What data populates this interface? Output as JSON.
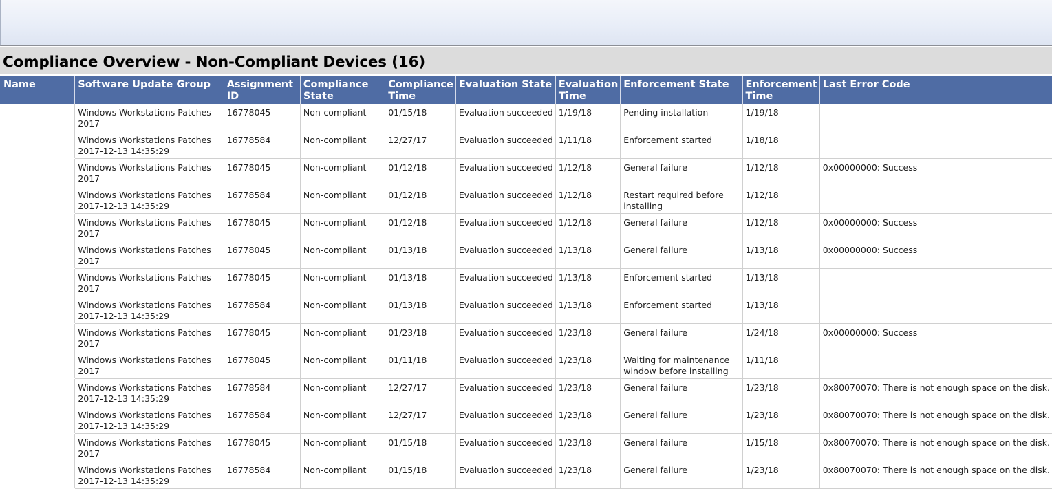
{
  "report": {
    "title": "Compliance Overview - Non-Compliant Devices (16)"
  },
  "table": {
    "headers": [
      "Name",
      "Software Update Group",
      "Assignment ID",
      "Compliance State",
      "Compliance Time",
      "Evaluation State",
      "Evaluation Time",
      "Enforcement State",
      "Enforcement Time",
      "Last Error Code"
    ],
    "rows": [
      [
        "",
        "Windows Workstations Patches 2017",
        "16778045",
        "Non-compliant",
        "01/15/18",
        "Evaluation succeeded",
        "1/19/18",
        "Pending installation",
        "1/19/18",
        ""
      ],
      [
        "",
        "Windows Workstations Patches 2017-12-13 14:35:29",
        "16778584",
        "Non-compliant",
        "12/27/17",
        "Evaluation succeeded",
        "1/11/18",
        "Enforcement started",
        "1/18/18",
        ""
      ],
      [
        "",
        "Windows Workstations Patches 2017",
        "16778045",
        "Non-compliant",
        "01/12/18",
        "Evaluation succeeded",
        "1/12/18",
        "General failure",
        "1/12/18",
        "0x00000000: Success"
      ],
      [
        "",
        "Windows Workstations Patches 2017-12-13 14:35:29",
        "16778584",
        "Non-compliant",
        "01/12/18",
        "Evaluation succeeded",
        "1/12/18",
        "Restart required before installing",
        "1/12/18",
        ""
      ],
      [
        "",
        "Windows Workstations Patches 2017",
        "16778045",
        "Non-compliant",
        "01/12/18",
        "Evaluation succeeded",
        "1/12/18",
        "General failure",
        "1/12/18",
        "0x00000000: Success"
      ],
      [
        "",
        "Windows Workstations Patches 2017",
        "16778045",
        "Non-compliant",
        "01/13/18",
        "Evaluation succeeded",
        "1/13/18",
        "General failure",
        "1/13/18",
        "0x00000000: Success"
      ],
      [
        "",
        "Windows Workstations Patches 2017",
        "16778045",
        "Non-compliant",
        "01/13/18",
        "Evaluation succeeded",
        "1/13/18",
        "Enforcement started",
        "1/13/18",
        ""
      ],
      [
        "",
        "Windows Workstations Patches 2017-12-13 14:35:29",
        "16778584",
        "Non-compliant",
        "01/13/18",
        "Evaluation succeeded",
        "1/13/18",
        "Enforcement started",
        "1/13/18",
        ""
      ],
      [
        "",
        "Windows Workstations Patches 2017",
        "16778045",
        "Non-compliant",
        "01/23/18",
        "Evaluation succeeded",
        "1/23/18",
        "General failure",
        "1/24/18",
        "0x00000000: Success"
      ],
      [
        "",
        "Windows Workstations Patches 2017",
        "16778045",
        "Non-compliant",
        "01/11/18",
        "Evaluation succeeded",
        "1/23/18",
        "Waiting for maintenance window before installing",
        "1/11/18",
        ""
      ],
      [
        "",
        "Windows Workstations Patches 2017-12-13 14:35:29",
        "16778584",
        "Non-compliant",
        "12/27/17",
        "Evaluation succeeded",
        "1/23/18",
        "General failure",
        "1/23/18",
        "0x80070070: There is not enough space on the disk."
      ],
      [
        "",
        "Windows Workstations Patches 2017-12-13 14:35:29",
        "16778584",
        "Non-compliant",
        "12/27/17",
        "Evaluation succeeded",
        "1/23/18",
        "General failure",
        "1/23/18",
        "0x80070070: There is not enough space on the disk."
      ],
      [
        "",
        "Windows Workstations Patches 2017",
        "16778045",
        "Non-compliant",
        "01/15/18",
        "Evaluation succeeded",
        "1/23/18",
        "General failure",
        "1/15/18",
        "0x80070070: There is not enough space on the disk."
      ],
      [
        "",
        "Windows Workstations Patches 2017-12-13 14:35:29",
        "16778584",
        "Non-compliant",
        "01/15/18",
        "Evaluation succeeded",
        "1/23/18",
        "General failure",
        "1/23/18",
        "0x80070070: There is not enough space on the disk."
      ]
    ]
  },
  "colors": {
    "header_bg": "#4f6ca4",
    "header_text": "#ffffff",
    "title_band": "#dcdcdc"
  }
}
